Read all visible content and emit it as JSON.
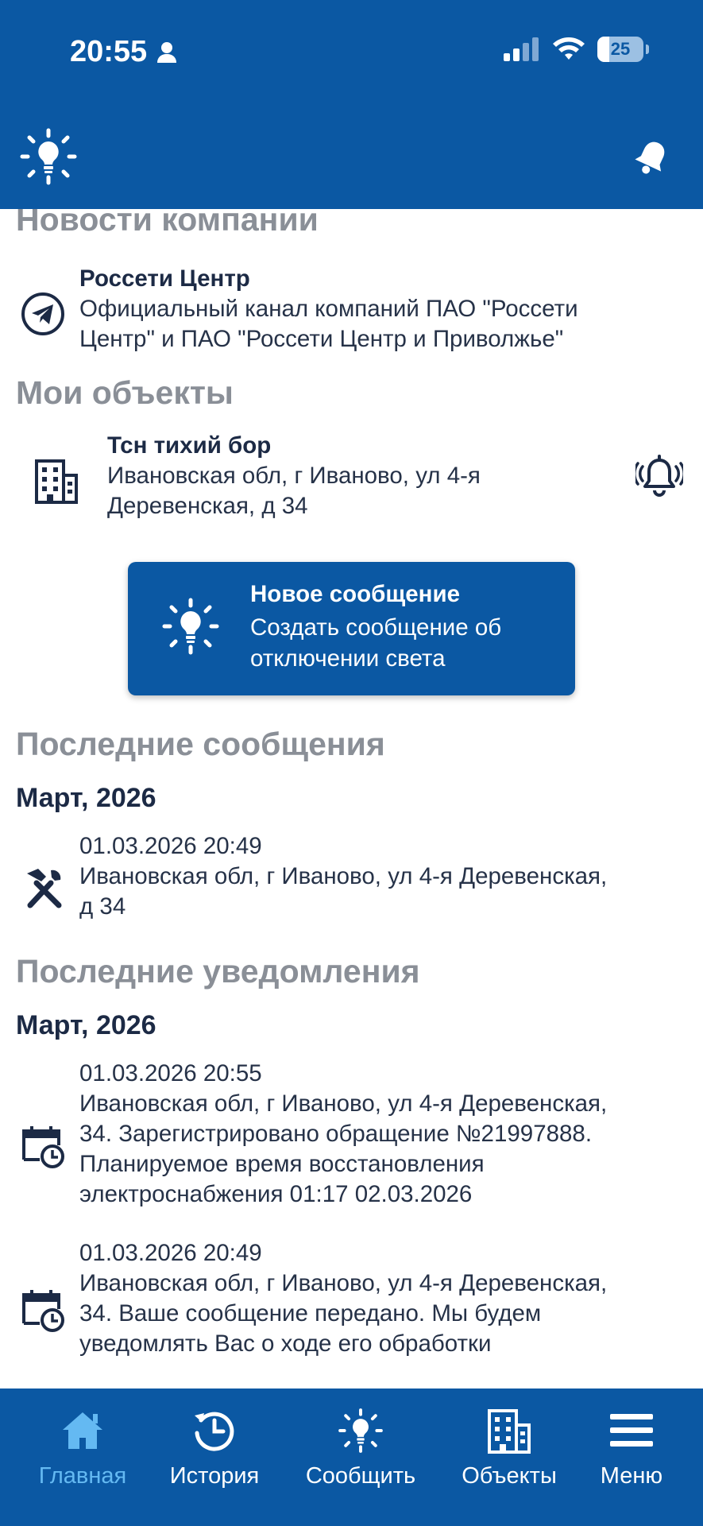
{
  "status_bar": {
    "time": "20:55",
    "battery_level": "25",
    "battery_fraction": 0.25
  },
  "sections": {
    "news_title": "Новости компании",
    "objects_title": "Мои объекты",
    "messages_title": "Последние сообщения",
    "notifications_title": "Последние уведомления"
  },
  "news": {
    "name": "Россети Центр",
    "description_line1": "Официальный канал компаний ПАО \"Россети",
    "description_line2": "Центр\" и ПАО \"Россети Центр и Приволжье\""
  },
  "object": {
    "name": "Тсн тихий бор",
    "address_line1": "Ивановская обл, г Иваново, ул 4-я",
    "address_line2": "Деревенская, д 34"
  },
  "new_message": {
    "title": "Новое сообщение",
    "subtitle_line1": "Создать сообщение об",
    "subtitle_line2": "отключении света"
  },
  "messages": {
    "month": "Март, 2026",
    "items": [
      {
        "date": "01.03.2026 20:49",
        "line1": "Ивановская обл, г Иваново, ул 4-я Деревенская,",
        "line2": "д 34"
      }
    ]
  },
  "notifications": {
    "month": "Март, 2026",
    "items": [
      {
        "date": "01.03.2026 20:55",
        "line1": "Ивановская обл, г Иваново, ул 4-я Деревенская,",
        "line2": "34. Зарегистрировано обращение №21997888.",
        "line3": "Планируемое время восстановления",
        "line4": "электроснабжения 01:17 02.03.2026"
      },
      {
        "date": "01.03.2026 20:49",
        "line1": "Ивановская обл, г Иваново, ул 4-я Деревенская,",
        "line2": "34. Ваше сообщение передано. Мы будем",
        "line3": "уведомлять Вас о ходе его обработки"
      }
    ]
  },
  "tabs": [
    {
      "label": "Главная",
      "icon": "home-icon",
      "active": true
    },
    {
      "label": "История",
      "icon": "history-icon",
      "active": false
    },
    {
      "label": "Сообщить",
      "icon": "report-bulb-icon",
      "active": false
    },
    {
      "label": "Объекты",
      "icon": "buildings-icon",
      "active": false
    },
    {
      "label": "Меню",
      "icon": "menu-icon",
      "active": false
    }
  ],
  "colors": {
    "primary": "#0b58a3",
    "active_tab": "#64b9f2",
    "section_gray": "#8a8f97",
    "text_dark": "#1c2a45"
  }
}
